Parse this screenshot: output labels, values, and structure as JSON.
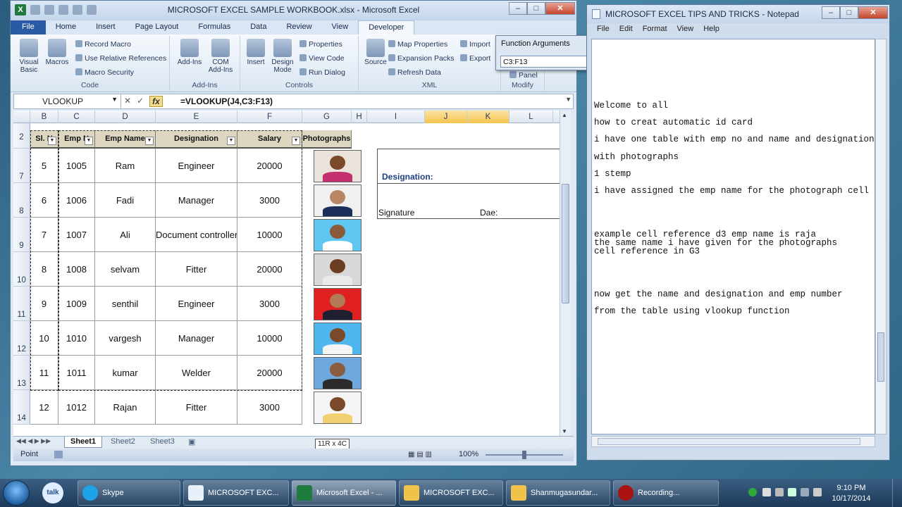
{
  "excel": {
    "title": "MICROSOFT EXCEL SAMPLE WORKBOOK.xlsx - Microsoft Excel",
    "logo": "X",
    "tabs": [
      {
        "label": "File"
      },
      {
        "label": "Home"
      },
      {
        "label": "Insert"
      },
      {
        "label": "Page Layout"
      },
      {
        "label": "Formulas"
      },
      {
        "label": "Data"
      },
      {
        "label": "Review"
      },
      {
        "label": "View"
      },
      {
        "label": "Developer"
      }
    ],
    "ribbon": {
      "code": {
        "label": "Code",
        "visual_basic": "Visual Basic",
        "macros": "Macros",
        "record_macro": "Record Macro",
        "relative_refs": "Use Relative References",
        "macro_security": "Macro Security"
      },
      "addins": {
        "label": "Add-Ins",
        "addins_btn": "Add-Ins",
        "com_addins": "COM Add-Ins"
      },
      "controls": {
        "label": "Controls",
        "insert": "Insert",
        "design_mode": "Design Mode",
        "properties": "Properties",
        "view_code": "View Code",
        "run_dialog": "Run Dialog"
      },
      "xml": {
        "label": "XML",
        "source": "Source",
        "map_properties": "Map Properties",
        "expansion_packs": "Expansion Packs",
        "refresh_data": "Refresh Data",
        "import": "Import",
        "export": "Export"
      },
      "modify": {
        "label": "Modify",
        "panel": "Panel"
      }
    },
    "namebox": "VLOOKUP",
    "formula": "=VLOOKUP(J4,C3:F13)",
    "fx": "fx",
    "columns": [
      "B",
      "C",
      "D",
      "E",
      "F",
      "G",
      "H",
      "I",
      "J",
      "K",
      "L"
    ],
    "table_headers": {
      "sl": "Sl. N",
      "empno": "Emp N",
      "empname": "Emp Name",
      "designation": "Designation",
      "salary": "Salary",
      "photo": "Photographs"
    },
    "header_row_num": "2",
    "rows": [
      {
        "rownum": "7",
        "sl": "5",
        "empno": "1005",
        "name": "Ram",
        "designation": "Engineer",
        "salary": "20000"
      },
      {
        "rownum": "8",
        "sl": "6",
        "empno": "1006",
        "name": "Fadi",
        "designation": "Manager",
        "salary": "3000"
      },
      {
        "rownum": "9",
        "sl": "7",
        "empno": "1007",
        "name": "Ali",
        "designation": "Document controller",
        "salary": "10000"
      },
      {
        "rownum": "10",
        "sl": "8",
        "empno": "1008",
        "name": "selvam",
        "designation": "Fitter",
        "salary": "20000"
      },
      {
        "rownum": "11",
        "sl": "9",
        "empno": "1009",
        "name": "senthil",
        "designation": "Engineer",
        "salary": "3000"
      },
      {
        "rownum": "12",
        "sl": "10",
        "empno": "1010",
        "name": "vargesh",
        "designation": "Manager",
        "salary": "10000"
      },
      {
        "rownum": "13",
        "sl": "11",
        "empno": "1011",
        "name": "kumar",
        "designation": "Welder",
        "salary": "20000"
      },
      {
        "rownum": "14",
        "sl": "12",
        "empno": "1012",
        "name": "Rajan",
        "designation": "Fitter",
        "salary": "3000"
      }
    ],
    "idcard": {
      "designation_label": "Designation:",
      "signature_label": "Signature",
      "date_label": "Dae:"
    },
    "sheets": [
      "Sheet1",
      "Sheet2",
      "Sheet3"
    ],
    "tooltip": "11R x 4C",
    "status_mode": "Point",
    "zoom": "100%"
  },
  "function_args": {
    "title": "Function Arguments",
    "input_value": "C3:F13"
  },
  "notepad": {
    "title": "MICROSOFT EXCEL TIPS AND TRICKS - Notepad",
    "menu": [
      "File",
      "Edit",
      "Format",
      "View",
      "Help"
    ],
    "lines": [
      "Welcome to all",
      "how to creat automatic id card",
      "i have one table with emp no and name and designation",
      "with photographs",
      "1 stemp",
      "i have assigned the emp name for the photograph cell",
      "example cell reference d3 emp name is raja",
      "the same name i have given for the photographs",
      "cell reference in G3",
      "now get the name and designation and emp number",
      "from the table using vlookup function"
    ]
  },
  "taskbar": {
    "items": [
      {
        "label": "Skype"
      },
      {
        "label": "MICROSOFT EXC..."
      },
      {
        "label": "Microsoft Excel - ..."
      },
      {
        "label": "MICROSOFT EXC..."
      },
      {
        "label": "Shanmugasundar..."
      },
      {
        "label": "Recording..."
      }
    ],
    "talk": "talk",
    "time": "9:10 PM",
    "date": "10/17/2014"
  },
  "colors": {
    "excel_accent": "#2a5aa5",
    "header_fill": "#ddd6c0",
    "selected_col": "#f5c54e"
  }
}
